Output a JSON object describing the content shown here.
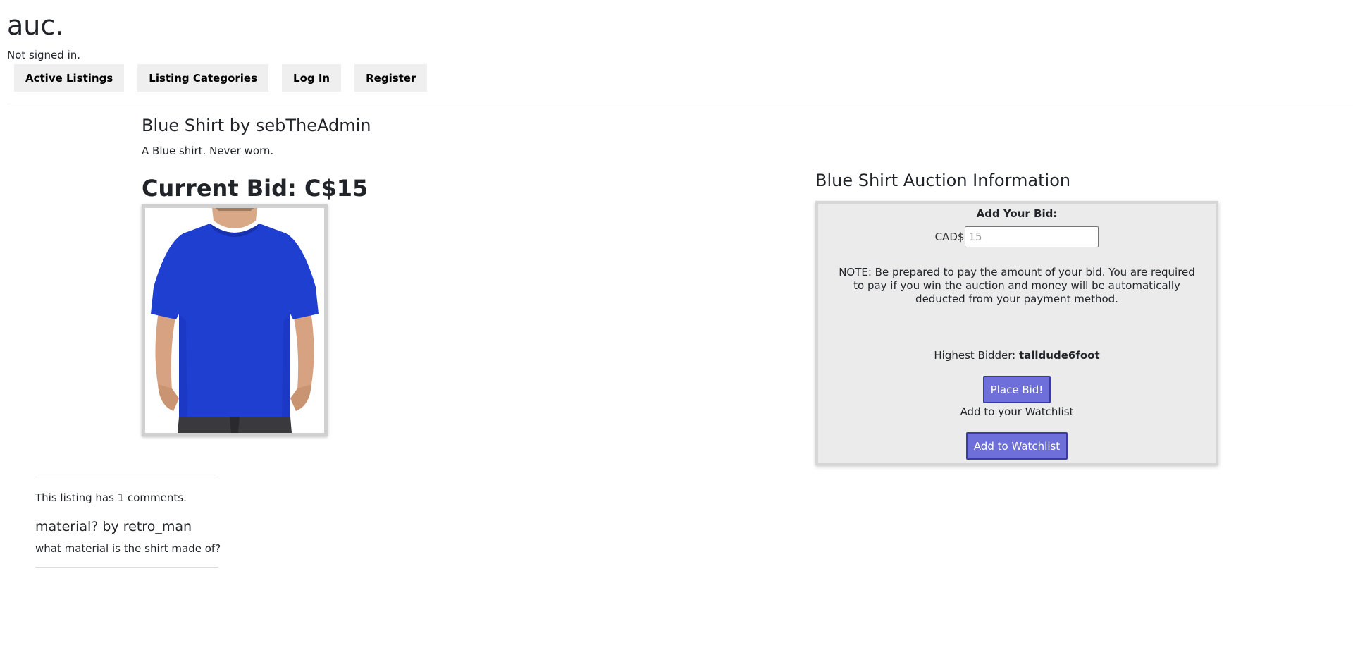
{
  "site": {
    "title": "auc.",
    "signin_status": "Not signed in."
  },
  "nav": {
    "items": [
      {
        "label": "Active Listings"
      },
      {
        "label": "Listing Categories"
      },
      {
        "label": "Log In"
      },
      {
        "label": "Register"
      }
    ]
  },
  "listing": {
    "title": "Blue Shirt by sebTheAdmin",
    "description": "A Blue shirt. Never worn.",
    "current_bid_label": "Current Bid: C$15",
    "image_alt": "blue t-shirt photo"
  },
  "auction": {
    "title": "Blue Shirt Auction Information",
    "bid_label": "Add Your Bid:",
    "currency": "CAD$",
    "bid_placeholder": "15",
    "note": "NOTE: Be prepared to pay the amount of your bid. You are required to pay if you win the auction and money will be automatically deducted from your payment method.",
    "highest_bidder_label": "Highest Bidder:",
    "highest_bidder": "talldude6foot",
    "place_bid_button": "Place Bid!",
    "watchlist_label": "Add to your Watchlist",
    "watchlist_button": "Add to Watchlist"
  },
  "comments": {
    "count_text": "This listing has 1 comments.",
    "items": [
      {
        "title": "material? by retro_man",
        "body": "what material is the shirt made of?"
      }
    ]
  },
  "colors": {
    "button_primary": "#6e6fd8",
    "button_border": "#3b3ba8",
    "panel_bg": "#ebebeb",
    "nav_btn_bg": "#efefef",
    "shirt": "#1f3fd0"
  }
}
